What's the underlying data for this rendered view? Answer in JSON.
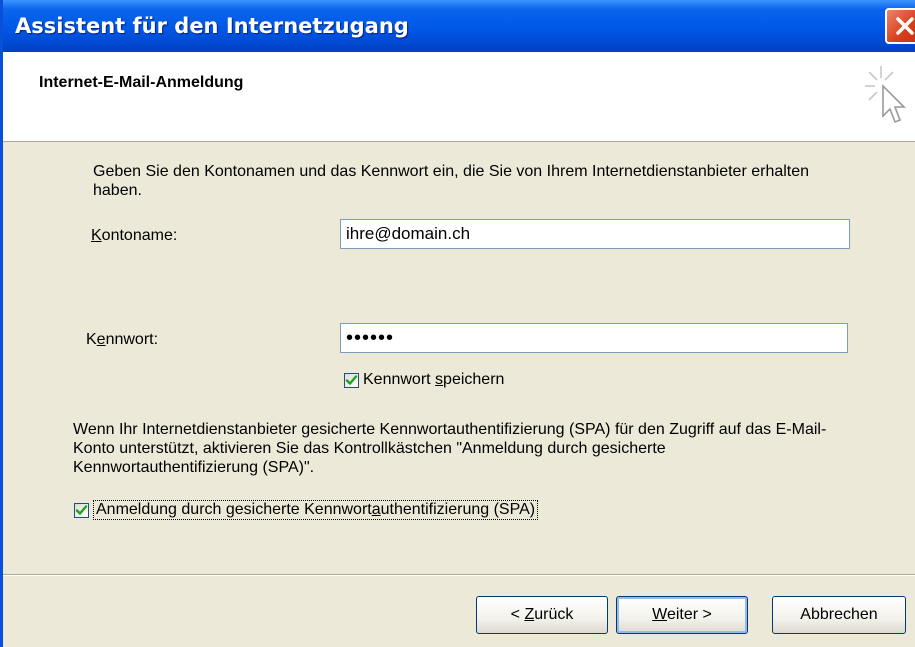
{
  "window": {
    "title": "Assistent für den Internetzugang"
  },
  "header": {
    "title": "Internet-E-Mail-Anmeldung"
  },
  "intro_text": "Geben Sie den Kontonamen und das Kennwort ein, die Sie von Ihrem Internetdienstanbieter erhalten haben.",
  "account": {
    "label_prefix": "",
    "label_mnemonic": "K",
    "label_rest": "ontoname:",
    "value": "ihre@domain.ch"
  },
  "password": {
    "label_prefix": "K",
    "label_mnemonic": "e",
    "label_rest": "nnwort:",
    "value": "••••••"
  },
  "save_password": {
    "label_prefix": "Kennwort ",
    "label_mnemonic": "s",
    "label_rest": "peichern",
    "checked": true
  },
  "spa_description": "Wenn Ihr Internetdienstanbieter gesicherte Kennwortauthentifizierung (SPA) für den Zugriff auf das E-Mail-Konto unterstützt, aktivieren Sie das Kontrollkästchen \"Anmeldung durch gesicherte Kennwortauthentifizierung (SPA)\".",
  "spa_checkbox": {
    "label_prefix": "Anmeldung durch gesicherte Kennwort",
    "label_mnemonic": "a",
    "label_rest": "uthentifizierung (SPA)",
    "checked": true
  },
  "buttons": {
    "back": {
      "prefix": "< ",
      "mnemonic": "Z",
      "rest": "urück"
    },
    "next": {
      "prefix": "",
      "mnemonic": "W",
      "rest": "eiter >"
    },
    "cancel": {
      "label": "Abbrechen"
    }
  },
  "colors": {
    "titlebar": "#0058e6",
    "check": "#21a121",
    "close": "#d8401c"
  }
}
